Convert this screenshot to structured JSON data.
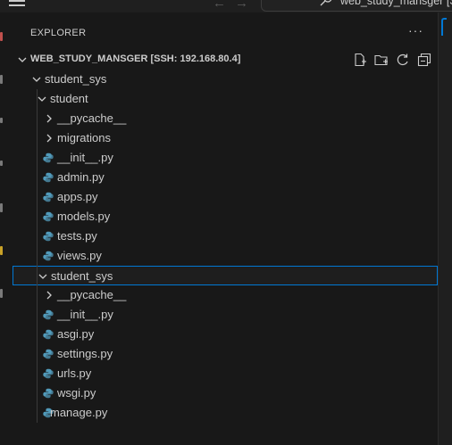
{
  "titlebar": {
    "window_title": "web_study_mansger [SS",
    "back_glyph": "←",
    "forward_glyph": "→"
  },
  "explorer": {
    "title": "EXPLORER",
    "more": "···",
    "section_title": "WEB_STUDY_MANSGER [SSH: 192.168.80.4]",
    "actions": [
      "new-file-icon",
      "new-folder-icon",
      "refresh-icon",
      "collapse-all-icon"
    ]
  },
  "tree": [
    {
      "label": "student_sys",
      "type": "folder",
      "expanded": true,
      "depth": 0
    },
    {
      "label": "student",
      "type": "folder",
      "expanded": true,
      "depth": 1
    },
    {
      "label": "__pycache__",
      "type": "folder",
      "expanded": false,
      "depth": 2
    },
    {
      "label": "migrations",
      "type": "folder",
      "expanded": false,
      "depth": 2
    },
    {
      "label": "__init__.py",
      "type": "python",
      "depth": 2
    },
    {
      "label": "admin.py",
      "type": "python",
      "depth": 2
    },
    {
      "label": "apps.py",
      "type": "python",
      "depth": 2
    },
    {
      "label": "models.py",
      "type": "python",
      "depth": 2
    },
    {
      "label": "tests.py",
      "type": "python",
      "depth": 2
    },
    {
      "label": "views.py",
      "type": "python",
      "depth": 2
    },
    {
      "label": "student_sys",
      "type": "folder",
      "expanded": true,
      "depth": 1,
      "selected": true
    },
    {
      "label": "__pycache__",
      "type": "folder",
      "expanded": false,
      "depth": 2
    },
    {
      "label": "__init__.py",
      "type": "python",
      "depth": 2
    },
    {
      "label": "asgi.py",
      "type": "python",
      "depth": 2
    },
    {
      "label": "settings.py",
      "type": "python",
      "depth": 2
    },
    {
      "label": "urls.py",
      "type": "python",
      "depth": 2
    },
    {
      "label": "wsgi.py",
      "type": "python",
      "depth": 2
    },
    {
      "label": "manage.py",
      "type": "python",
      "depth": 1
    }
  ],
  "colors": {
    "background": "#181818",
    "text": "#cccccc",
    "selection_border": "#0078d4",
    "python_icon": "#519aba"
  }
}
